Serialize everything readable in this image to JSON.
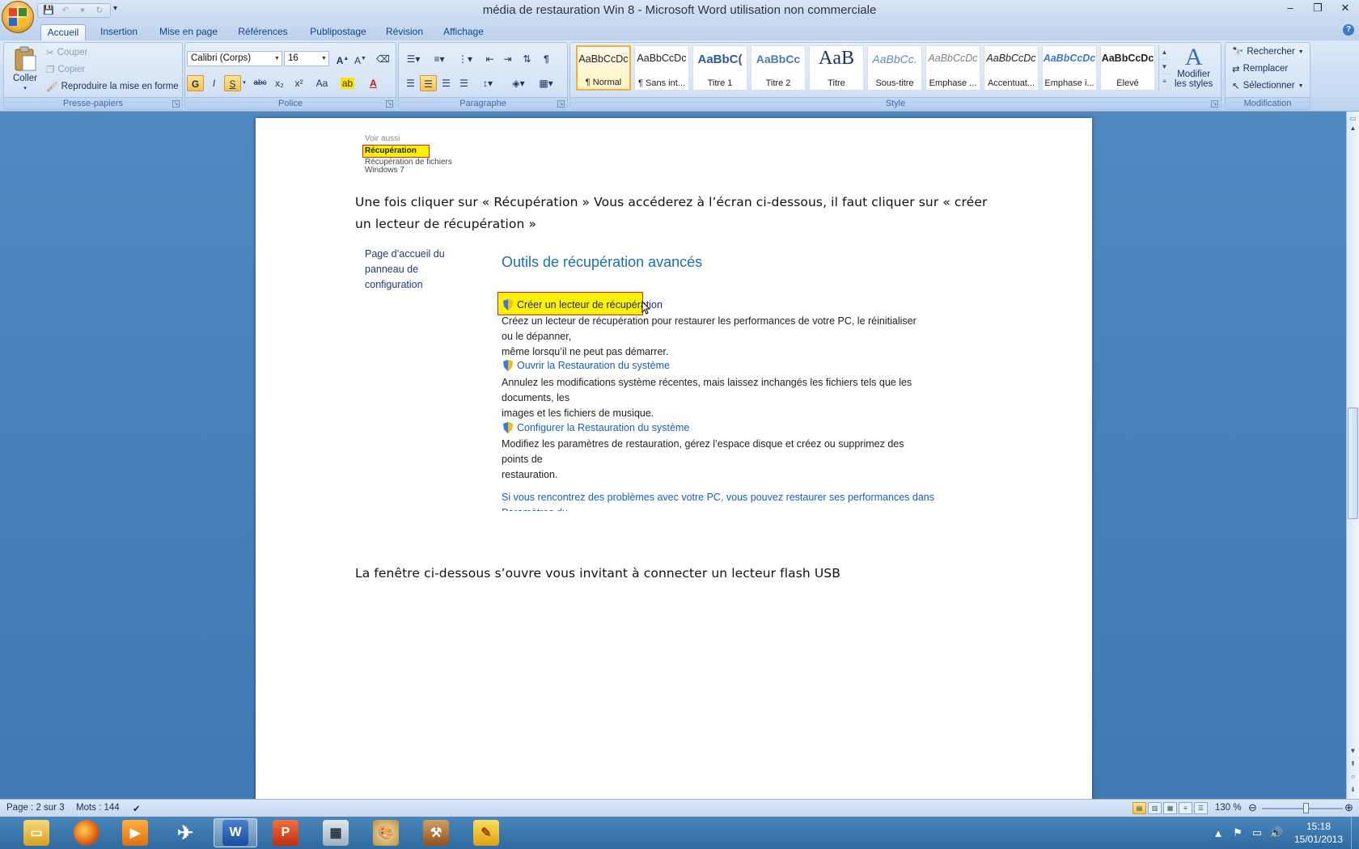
{
  "window": {
    "title": "média de restauration Win 8 - Microsoft Word utilisation non commerciale",
    "controls": [
      "–",
      "❐",
      "✕"
    ]
  },
  "tabs": [
    "Accueil",
    "Insertion",
    "Mise en page",
    "Références",
    "Publipostage",
    "Révision",
    "Affichage"
  ],
  "ribbon": {
    "clipboard": {
      "label": "Presse-papiers",
      "paste": "Coller",
      "cut": "Couper",
      "copy": "Copier",
      "format_painter": "Reproduire la mise en forme"
    },
    "font": {
      "label": "Police",
      "family": "Calibri (Corps)",
      "size": "16",
      "bold": "G",
      "italic": "I",
      "underline": "S",
      "strike": "abc",
      "subscript": "x₂",
      "superscript": "x²",
      "case": "Aa"
    },
    "paragraph": {
      "label": "Paragraphe"
    },
    "styles": {
      "label": "Style",
      "items": [
        {
          "sample": "AaBbCcDc",
          "name": "¶ Normal"
        },
        {
          "sample": "AaBbCcDc",
          "name": "¶ Sans int..."
        },
        {
          "sample": "AaBbC(",
          "name": "Titre 1"
        },
        {
          "sample": "AaBbCc",
          "name": "Titre 2"
        },
        {
          "sample": "AaB",
          "name": "Titre"
        },
        {
          "sample": "AaBbCc.",
          "name": "Sous-titre"
        },
        {
          "sample": "AaBbCcDc",
          "name": "Emphase ..."
        },
        {
          "sample": "AaBbCcDc",
          "name": "Accentuat..."
        },
        {
          "sample": "AaBbCcDc",
          "name": "Emphase i..."
        },
        {
          "sample": "AaBbCcDc",
          "name": "Élevé"
        }
      ],
      "change_styles_line1": "Modifier",
      "change_styles_line2": "les styles"
    },
    "editing": {
      "label": "Modification",
      "find": "Rechercher",
      "replace": "Remplacer",
      "select": "Sélectionner"
    }
  },
  "document": {
    "snippet_top": {
      "see_also": "Voir aussi",
      "recovery": "Récupération",
      "file_recovery": "Récupération de fichiers",
      "windows7": "Windows 7"
    },
    "paragraph1_line1": "Une fois cliquer sur « Récupération » Vous accéderez à l’écran ci-dessous, il faut cliquer sur « créer",
    "paragraph1_line2": "un lecteur de récupération »",
    "control_panel": {
      "home_line1": "Page d’accueil du panneau de",
      "home_line2": "configuration",
      "title": "Outils de récupération avancés",
      "link1": "Créer un lecteur de récupération",
      "desc1_line1": "Créez un lecteur de récupération pour restaurer les performances de votre PC, le réinitialiser ou le dépanner,",
      "desc1_line2": "même lorsqu’il ne peut pas démarrer.",
      "link2": "Ouvrir la Restauration du système",
      "desc2_line1": "Annulez les modifications système récentes, mais laissez inchangés les fichiers tels que les documents, les",
      "desc2_line2": "images et les fichiers de musique.",
      "link3": "Configurer la Restauration du système",
      "desc3_line1": "Modifiez les paramètres de restauration, gérez l’espace disque et créez ou supprimez des points de",
      "desc3_line2": "restauration.",
      "footer_link": "Si vous rencontrez des problèmes avec votre PC, vous pouvez restaurer ses performances dans Paramètres du"
    },
    "paragraph2": "La fenêtre ci-dessous s’ouvre vous invitant à connecter un lecteur flash USB"
  },
  "status": {
    "page": "Page : 2 sur 3",
    "words": "Mots : 144",
    "zoom": "130 %",
    "zoom_level_percent": 130
  },
  "taskbar": {
    "apps": [
      "file-explorer",
      "firefox",
      "media-player",
      "airplane-app",
      "word",
      "powerpoint",
      "calculator",
      "paint",
      "tools-app",
      "pencil-app"
    ],
    "time": "15:18",
    "date": "15/01/2013"
  },
  "colors": {
    "accent": "#15428b",
    "highlight": "#fff200",
    "highlight_border": "#e02020",
    "link": "#1660b8"
  }
}
